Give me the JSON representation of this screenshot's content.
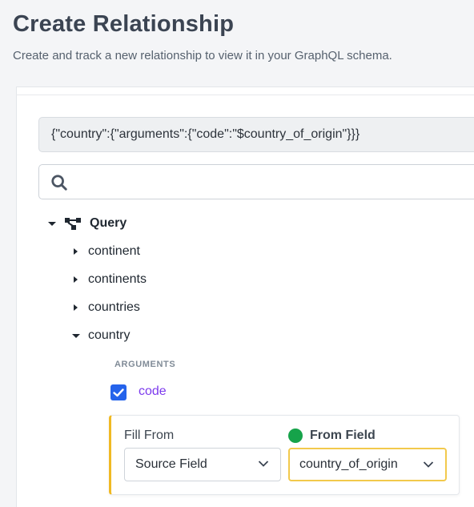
{
  "header": {
    "title": "Create Relationship",
    "subtitle": "Create and track a new relationship to view it in your GraphQL schema."
  },
  "query_preview": "{\"country\":{\"arguments\":{\"code\":\"$country_of_origin\"}}}",
  "search": {
    "placeholder": ""
  },
  "tree": {
    "root_label": "Query",
    "items": [
      {
        "label": "continent",
        "expanded": false
      },
      {
        "label": "continents",
        "expanded": false
      },
      {
        "label": "countries",
        "expanded": false
      },
      {
        "label": "country",
        "expanded": true
      }
    ],
    "arguments_label": "ARGUMENTS",
    "argument": {
      "label": "code",
      "checked": true
    }
  },
  "fill": {
    "fill_from_label": "Fill From",
    "fill_from_value": "Source Field",
    "from_field_label": "From Field",
    "from_field_value": "country_of_origin"
  },
  "colors": {
    "checkbox": "#2563eb",
    "argument_text": "#7c3aed",
    "status_dot": "#16a34a",
    "card_accent": "#f0b923"
  }
}
